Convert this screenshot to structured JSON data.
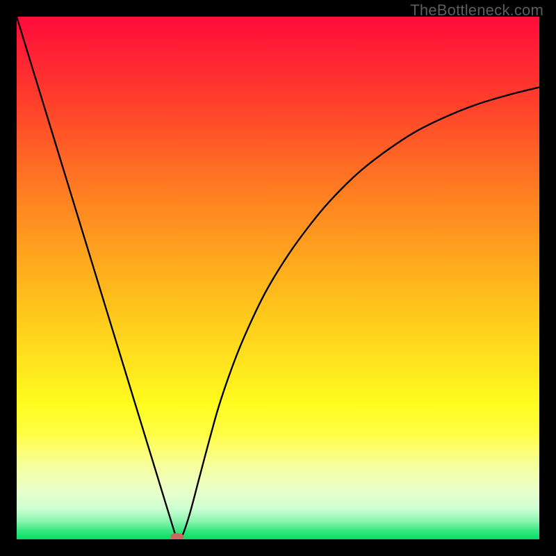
{
  "watermark": "TheBottleneck.com",
  "chart_data": {
    "type": "line",
    "title": "",
    "xlabel": "",
    "ylabel": "",
    "xlim": [
      0,
      100
    ],
    "ylim": [
      0,
      100
    ],
    "background_gradient": {
      "stops": [
        {
          "offset": 0.0,
          "color": "#ff0b3a"
        },
        {
          "offset": 0.16,
          "color": "#ff3e2b"
        },
        {
          "offset": 0.35,
          "color": "#ff8321"
        },
        {
          "offset": 0.55,
          "color": "#ffc21c"
        },
        {
          "offset": 0.74,
          "color": "#fffb1e"
        },
        {
          "offset": 0.8,
          "color": "#fffe47"
        },
        {
          "offset": 0.86,
          "color": "#f6ff9f"
        },
        {
          "offset": 0.905,
          "color": "#eaffc8"
        },
        {
          "offset": 0.94,
          "color": "#d0ffd4"
        },
        {
          "offset": 0.965,
          "color": "#8cf5b0"
        },
        {
          "offset": 0.985,
          "color": "#2fe77d"
        },
        {
          "offset": 1.0,
          "color": "#06db63"
        }
      ]
    },
    "series": [
      {
        "name": "bottleneck-curve",
        "x": [
          0,
          3,
          6,
          9,
          12,
          15,
          18,
          21,
          24,
          27,
          30,
          30.7,
          31.5,
          33,
          35,
          37,
          39,
          42,
          45,
          48,
          52,
          56,
          60,
          65,
          70,
          76,
          82,
          88,
          94,
          100
        ],
        "values": [
          100,
          90.2,
          80.4,
          70.6,
          60.8,
          51.0,
          41.2,
          31.4,
          21.6,
          11.8,
          2.0,
          0.0,
          0.3,
          4.5,
          12.0,
          19.5,
          26.5,
          35.0,
          42.0,
          48.0,
          54.5,
          60.0,
          64.8,
          69.8,
          73.8,
          77.8,
          80.8,
          83.2,
          85.0,
          86.5
        ]
      }
    ],
    "marker": {
      "x": 30.7,
      "y": 0.5,
      "color": "#c96a62",
      "rx": 1.3,
      "ry": 0.7
    },
    "annotations": []
  }
}
